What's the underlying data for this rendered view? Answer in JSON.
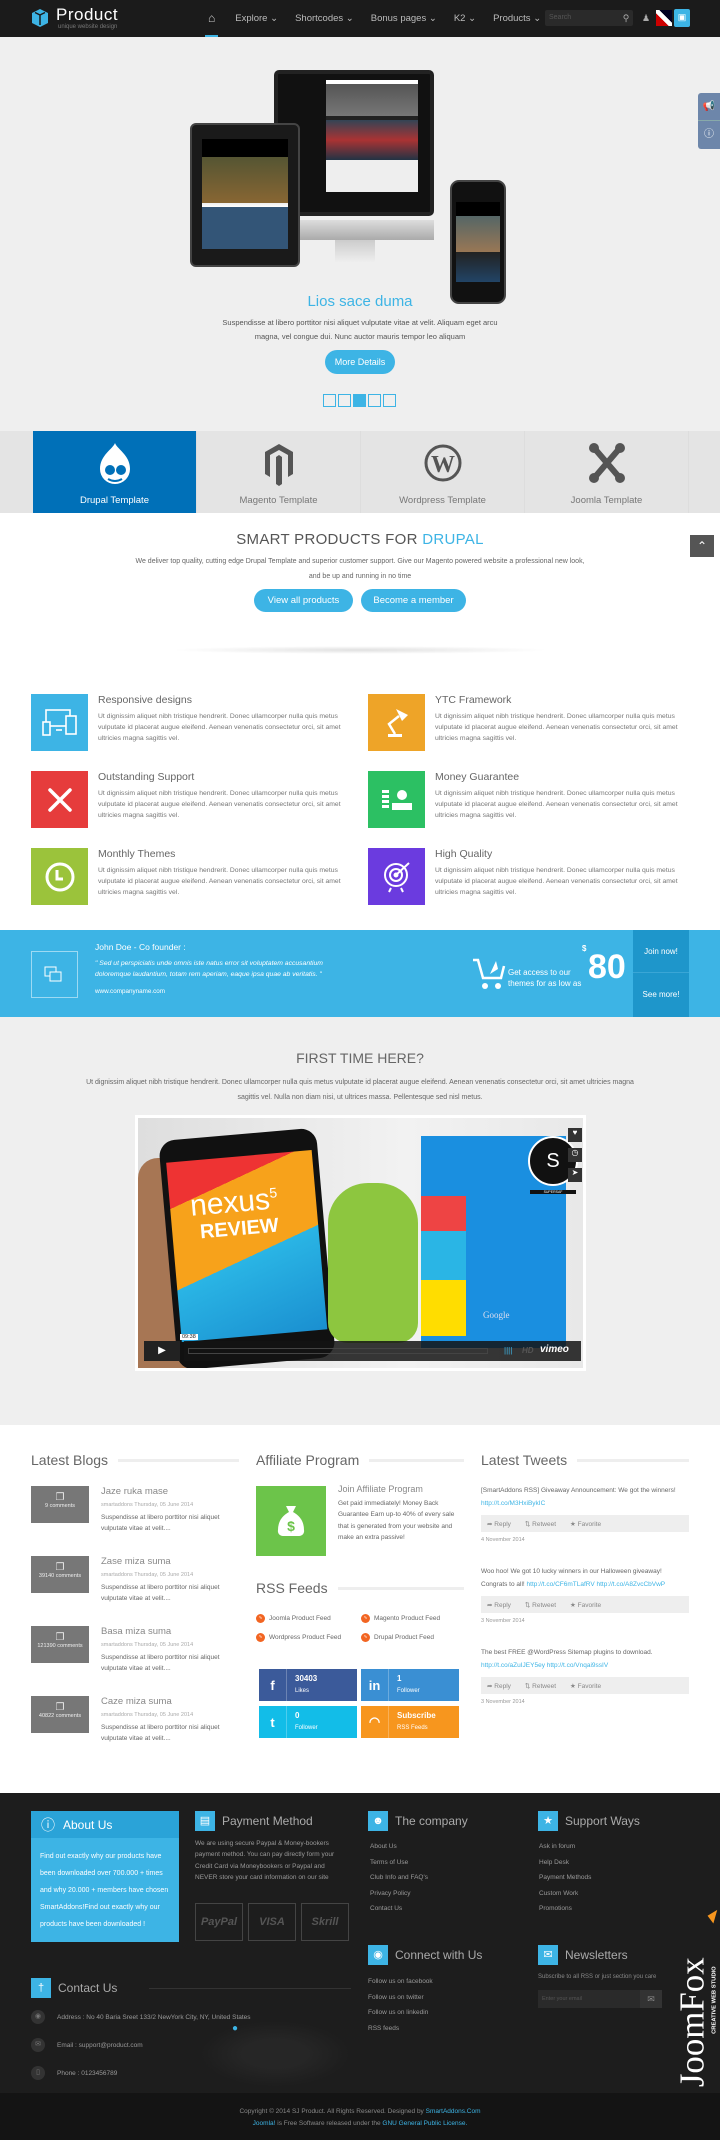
{
  "nav": {
    "logo_title": "Product",
    "logo_subtitle": "unique website design",
    "items": [
      "Explore",
      "Shortcodes",
      "Bonus pages",
      "K2",
      "Products"
    ],
    "search_placeholder": "Search"
  },
  "hero": {
    "title": "Lios sace duma",
    "text": "Suspendisse at libero porttitor nisi aliquet vulputate vitae at velit. Aliquam eget arcu magna, vel congue dui. Nunc auctor mauris tempor leo aliquam",
    "button": "More Details",
    "slides": 5,
    "active_slide": 3
  },
  "tabs": [
    {
      "label": "Drupal Template",
      "icon": "drupal-icon",
      "active": true
    },
    {
      "label": "Magento Template",
      "icon": "magento-icon"
    },
    {
      "label": "Wordpress Template",
      "icon": "wordpress-icon"
    },
    {
      "label": "Joomla Template",
      "icon": "joomla-icon"
    }
  ],
  "smart": {
    "title": "SMART PRODUCTS FOR",
    "highlight": "DRUPAL",
    "text": "We deliver top quality, cutting edge Drupal Template and superior customer support. Give our Magento powered website a professional new look, and be up and running in no time",
    "btn1": "View all products",
    "btn2": "Become a member"
  },
  "features": [
    {
      "title": "Responsive designs",
      "color": "#3db4e5",
      "icon": "devices-icon",
      "text": "Ut dignissim aliquet nibh tristique hendrerit. Donec ullamcorper nulla quis metus vulputate id placerat augue eleifend. Aenean venenatis consectetur orci, sit amet ultricies magna sagittis vel."
    },
    {
      "title": "YTC Framework",
      "color": "#eea428",
      "icon": "lamp-icon",
      "text": "Ut dignissim aliquet nibh tristique hendrerit. Donec ullamcorper nulla quis metus vulputate id placerat augue eleifend. Aenean venenatis consectetur orci, sit amet ultricies magna sagittis vel."
    },
    {
      "title": "Outstanding Support",
      "color": "#e63c3c",
      "icon": "tools-icon",
      "text": "Ut dignissim aliquet nibh tristique hendrerit. Donec ullamcorper nulla quis metus vulputate id placerat augue eleifend. Aenean venenatis consectetur orci, sit amet ultricies magna sagittis vel."
    },
    {
      "title": "Money Guarantee",
      "color": "#2cc063",
      "icon": "money-icon",
      "text": "Ut dignissim aliquet nibh tristique hendrerit. Donec ullamcorper nulla quis metus vulputate id placerat augue eleifend. Aenean venenatis consectetur orci, sit amet ultricies magna sagittis vel."
    },
    {
      "title": "Monthly Themes",
      "color": "#9bc33b",
      "icon": "clock-icon",
      "text": "Ut dignissim aliquet nibh tristique hendrerit. Donec ullamcorper nulla quis metus vulputate id placerat augue eleifend. Aenean venenatis consectetur orci, sit amet ultricies magna sagittis vel."
    },
    {
      "title": "High Quality",
      "color": "#6b3bdf",
      "icon": "target-icon",
      "text": "Ut dignissim aliquet nibh tristique hendrerit. Donec ullamcorper nulla quis metus vulputate id placerat augue eleifend. Aenean venenatis consectetur orci, sit amet ultricies magna sagittis vel."
    }
  ],
  "banner": {
    "name": "John Doe - Co founder :",
    "quote": "\" Sed ut perspiciatis unde omnis iste natus error sit voluptatem accusantium doloremque laudantium, totam rem aperiam, eaque ipsa quae ab veritatis. \"",
    "url": "www.companyname.com",
    "offer": "Get access to our themes for as low as",
    "currency": "$",
    "price": "80",
    "join": "Join now!",
    "more": "See more!"
  },
  "first": {
    "title": "FIRST TIME HERE?",
    "text": "Ut dignissim aliquet nibh tristique hendrerit. Donec ullamcorper nulla quis metus vulputate id placerat augue eleifend. Aenean venenatis consectetur orci, sit amet ultricies magna sagittis vel. Nulla non diam nisi, ut ultrices massa. Pellentesque sed nisl metus.",
    "video": {
      "screen_title": "nexus",
      "screen_sup": "5",
      "screen_sub": "REVIEW",
      "time": "09:38",
      "hd": "HD",
      "brand": "vimeo",
      "box_brand": "Google",
      "channel": "SUPERSAF"
    }
  },
  "blogs": {
    "title": "Latest Blogs",
    "items": [
      {
        "title": "Jaze ruka mase",
        "comments": "9 comments",
        "meta": "smartaddons  Thursday, 05 June 2014",
        "text": "Suspendisse at libero porttitor nisi aliquet vulputate vitae at velit...."
      },
      {
        "title": "Zase miza suma",
        "comments": "39140 comments",
        "meta": "smartaddons  Thursday, 05 June 2014",
        "text": "Suspendisse at libero porttitor nisi aliquet vulputate vitae at velit...."
      },
      {
        "title": "Basa miza suma",
        "comments": "121390 comments",
        "meta": "smartaddons  Thursday, 05 June 2014",
        "text": "Suspendisse at libero porttitor nisi aliquet vulputate vitae at velit...."
      },
      {
        "title": "Caze miza suma",
        "comments": "40822 comments",
        "meta": "smartaddons  Thursday, 05 June 2014",
        "text": "Suspendisse at libero porttitor nisi aliquet vulputate vitae at velit...."
      }
    ]
  },
  "affiliate": {
    "title": "Affiliate Program",
    "heading": "Join Affiliate Program",
    "text": "Get paid immediately! Money Back Guarantee Earn up-to 40% of every sale that is generated from your website and make an extra passive!"
  },
  "rss": {
    "title": "RSS Feeds",
    "feeds": [
      "Joomla Product Feed",
      "Magento Product Feed",
      "Wordpress Product Feed",
      "Drupal Product Feed"
    ]
  },
  "social": [
    {
      "icon": "facebook-icon",
      "glyph": "f",
      "count": "30403",
      "label": "Likes",
      "color": "#3b5a9a"
    },
    {
      "icon": "linkedin-icon",
      "glyph": "in",
      "count": "1",
      "label": "Follower",
      "color": "#3a8fd3"
    },
    {
      "icon": "twitter-icon",
      "glyph": "t",
      "count": "0",
      "label": "Follower",
      "color": "#12bde8"
    },
    {
      "icon": "rss-icon",
      "glyph": "◠",
      "count": "Subscribe",
      "label": "RSS Feeds",
      "color": "#f7961e"
    }
  ],
  "tweets": {
    "title": "Latest Tweets",
    "reply": "Reply",
    "retweet": "Retweet",
    "favorite": "Favorite",
    "items": [
      {
        "text": "[SmartAddons RSS] Giveaway Announcement: We got the winners!",
        "link": "http://t.co/M3HxiBykIC",
        "link2": "",
        "date": "4 November 2014"
      },
      {
        "text": "Woo hoo! We got 10 lucky winners in our Halloween giveaway! Congrats to all!",
        "link": "http://t.co/CF6mTLafRV",
        "link2": "http://t.co/A8ZvcCbVwP",
        "date": "3 November 2014"
      },
      {
        "text": "The best FREE @WordPress Sitemap plugins to download.",
        "link": "http://t.co/aZuIJEY5ey",
        "link2": "http://t.co/Vnqai9ssIV",
        "date": "3 November 2014"
      }
    ]
  },
  "footer": {
    "about": {
      "title": "About Us",
      "text": "Find out exactly why our products have been downloaded over 700.000 + times and why 20.000 + members have chosen SmartAddons!Find out exactly why our products have been downloaded !"
    },
    "payment": {
      "title": "Payment Method",
      "text": "We are using secure Paypal & Money-bookers payment method. You can pay directly form your Credit Card via Moneybookers or Paypal and NEVER store your card information on our site",
      "logos": [
        "PayPal",
        "VISA",
        "Skrill"
      ]
    },
    "company": {
      "title": "The company",
      "links": [
        "About Us",
        "Terms of Use",
        "Club Info and FAQ's",
        "Privacy Policy",
        "Contact Us"
      ]
    },
    "support": {
      "title": "Support Ways",
      "links": [
        "Ask in forum",
        "Help Desk",
        "Payment Methods",
        "Custom Work",
        "Promotions"
      ]
    },
    "contact": {
      "title": "Contact Us",
      "address": "Address : No 40 Baria Sreet 133/2 NewYork City, NY, United States",
      "email": "Email : support@product.com",
      "phone": "Phone : 0123456789"
    },
    "connect": {
      "title": "Connect with Us",
      "links": [
        "Follow us on facebook",
        "Follow us on twitter",
        "Follow us on linkedin",
        "RSS feeds"
      ]
    },
    "newsletter": {
      "title": "Newsletters",
      "text": "Subscribe to all RSS or just section you care",
      "placeholder": "Enter your email"
    },
    "watermark": "JoomFox CREATIVE WEB STUDIO"
  },
  "bottom": {
    "line1": "Copyright © 2014 SJ Product. All Rights Reserved. Designed by",
    "designer": "SmartAddons.Com",
    "joomla": "Joomla!",
    "line2": "is Free Software released under the",
    "license": "GNU General Public License."
  },
  "colors": {
    "accent": "#3db4e5",
    "drupal": "#0070b8",
    "footer": "#1d1d1d"
  }
}
